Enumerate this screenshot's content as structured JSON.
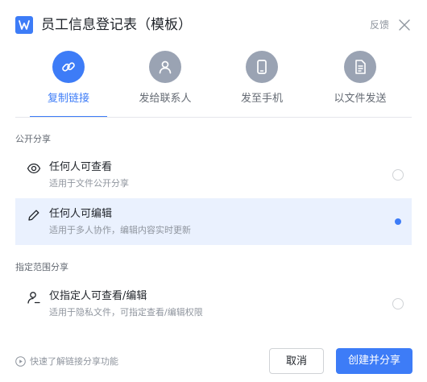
{
  "header": {
    "app_icon": "word-doc-icon",
    "title": "员工信息登记表（模板）",
    "feedback_label": "反馈",
    "close_icon": "close-icon"
  },
  "share_methods": [
    {
      "label": "复制链接",
      "icon": "link-icon",
      "active": true
    },
    {
      "label": "发给联系人",
      "icon": "contact-icon",
      "active": false
    },
    {
      "label": "发至手机",
      "icon": "phone-icon",
      "active": false
    },
    {
      "label": "以文件发送",
      "icon": "file-icon",
      "active": false
    }
  ],
  "public_section": {
    "label": "公开分享",
    "options": [
      {
        "title": "任何人可查看",
        "desc": "适用于文件公开分享",
        "icon": "eye-icon",
        "selected": false
      },
      {
        "title": "任何人可编辑",
        "desc": "适用于多人协作，编辑内容实时更新",
        "icon": "pencil-icon",
        "selected": true
      }
    ]
  },
  "restricted_section": {
    "label": "指定范围分享",
    "options": [
      {
        "title": "仅指定人可查看/编辑",
        "desc": "适用于隐私文件，可指定查看/编辑权限",
        "icon": "user-lock-icon",
        "selected": false
      }
    ]
  },
  "footer": {
    "help_text": "快速了解链接分享功能",
    "help_icon": "play-circle-icon",
    "cancel_label": "取消",
    "create_label": "创建并分享"
  },
  "colors": {
    "accent": "#3d7cf7",
    "inactive_icon_bg": "#9aa3b3",
    "selected_row_bg": "#eaf1fe"
  }
}
